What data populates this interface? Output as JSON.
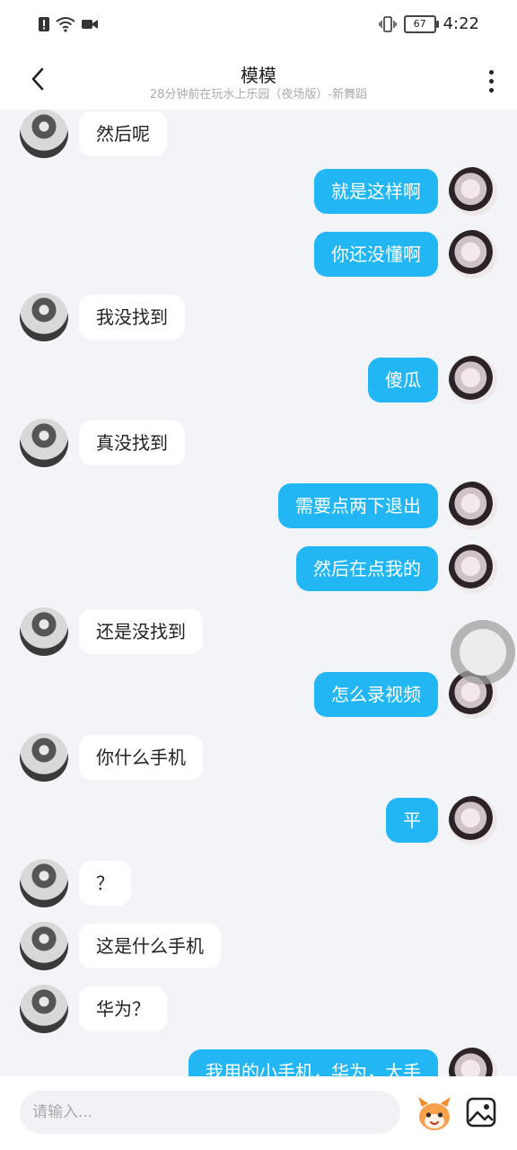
{
  "status_bar": {
    "time": "4:22",
    "battery": "67"
  },
  "header": {
    "title": "模模",
    "subtitle": "28分钟前在玩水上乐园（夜场版）-新舞蹈"
  },
  "messages": [
    {
      "side": "in",
      "text": "然后呢"
    },
    {
      "side": "out",
      "text": "就是这样啊"
    },
    {
      "side": "out",
      "text": "你还没懂啊"
    },
    {
      "side": "in",
      "text": "我没找到"
    },
    {
      "side": "out",
      "text": "傻瓜"
    },
    {
      "side": "in",
      "text": "真没找到"
    },
    {
      "side": "out",
      "text": "需要点两下退出"
    },
    {
      "side": "out",
      "text": "然后在点我的"
    },
    {
      "side": "in",
      "text": "还是没找到"
    },
    {
      "side": "out",
      "text": "怎么录视频"
    },
    {
      "side": "in",
      "text": "你什么手机"
    },
    {
      "side": "out",
      "text": "平"
    },
    {
      "side": "in",
      "text": "？"
    },
    {
      "side": "in",
      "text": "这是什么手机"
    },
    {
      "side": "in",
      "text": "华为？"
    },
    {
      "side": "out",
      "text": "我用的小手机，华为，大手"
    }
  ],
  "input": {
    "placeholder": "请输入..."
  },
  "icons": {
    "back": "chevron-left-icon",
    "more": "more-vertical-icon",
    "emoji": "emoji-mascot-icon",
    "image": "image-icon"
  },
  "colors": {
    "accent": "#22b6f5",
    "background": "#f3f4f8"
  }
}
